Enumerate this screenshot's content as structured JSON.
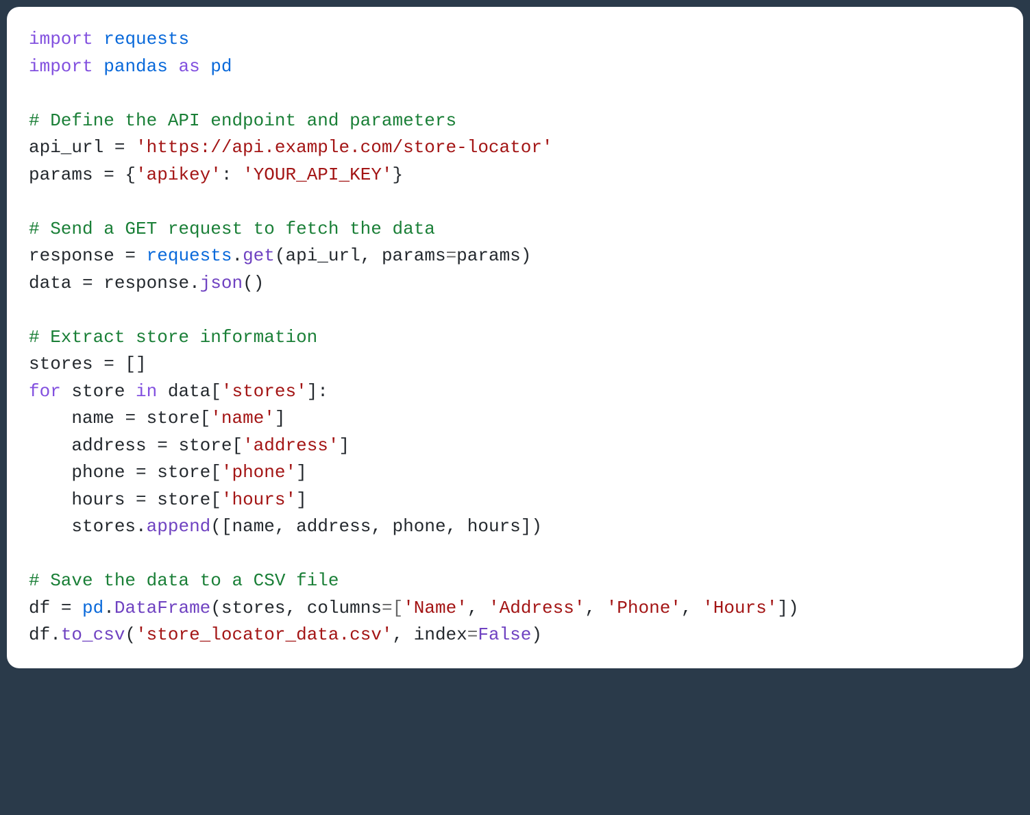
{
  "code": {
    "line1": {
      "kw": "import",
      "mod": "requests"
    },
    "line2": {
      "kw": "import",
      "mod": "pandas",
      "as": "as",
      "alias": "pd"
    },
    "line4": {
      "comment": "# Define the API endpoint and parameters"
    },
    "line5": {
      "var": "api_url",
      "eq": " = ",
      "str": "'https://api.example.com/store-locator'"
    },
    "line6": {
      "var": "params",
      "eq": " = {",
      "key": "'apikey'",
      "colon": ": ",
      "val": "'YOUR_API_KEY'",
      "close": "}"
    },
    "line8": {
      "comment": "# Send a GET request to fetch the data"
    },
    "line9": {
      "var": "response",
      "eq": " = ",
      "obj": "requests",
      "dot": ".",
      "fn": "get",
      "open": "(",
      "arg1": "api_url",
      "comma": ", ",
      "kw2": "params",
      "eq2": "=",
      "arg2": "params",
      "close": ")"
    },
    "line10": {
      "var": "data",
      "eq": " = ",
      "obj": "response",
      "dot": ".",
      "fn": "json",
      "parens": "()"
    },
    "line12": {
      "comment": "# Extract store information"
    },
    "line13": {
      "var": "stores",
      "eq": " = []"
    },
    "line14": {
      "for": "for",
      "var": " store ",
      "in": "in",
      "obj": " data[",
      "key": "'stores'",
      "close": "]:"
    },
    "line15": {
      "indent": "    ",
      "var": "name",
      "eq": " = store[",
      "key": "'name'",
      "close": "]"
    },
    "line16": {
      "indent": "    ",
      "var": "address",
      "eq": " = store[",
      "key": "'address'",
      "close": "]"
    },
    "line17": {
      "indent": "    ",
      "var": "phone",
      "eq": " = store[",
      "key": "'phone'",
      "close": "]"
    },
    "line18": {
      "indent": "    ",
      "var": "hours",
      "eq": " = store[",
      "key": "'hours'",
      "close": "]"
    },
    "line19": {
      "indent": "    ",
      "obj": "stores",
      "dot": ".",
      "fn": "append",
      "open": "([",
      "args": "name, address, phone, hours",
      "close": "])"
    },
    "line21": {
      "comment": "# Save the data to a CSV file"
    },
    "line22": {
      "var": "df",
      "eq": " = ",
      "obj": "pd",
      "dot": ".",
      "cls": "DataFrame",
      "open": "(",
      "arg1": "stores",
      "comma": ", ",
      "kw": "columns",
      "eq2": "=[",
      "s1": "'Name'",
      "c1": ", ",
      "s2": "'Address'",
      "c2": ", ",
      "s3": "'Phone'",
      "c3": ", ",
      "s4": "'Hours'",
      "close": "])"
    },
    "line23": {
      "obj": "df",
      "dot": ".",
      "fn": "to_csv",
      "open": "(",
      "str": "'store_locator_data.csv'",
      "comma": ", ",
      "kw": "index",
      "eq": "=",
      "val": "False",
      "close": ")"
    }
  }
}
